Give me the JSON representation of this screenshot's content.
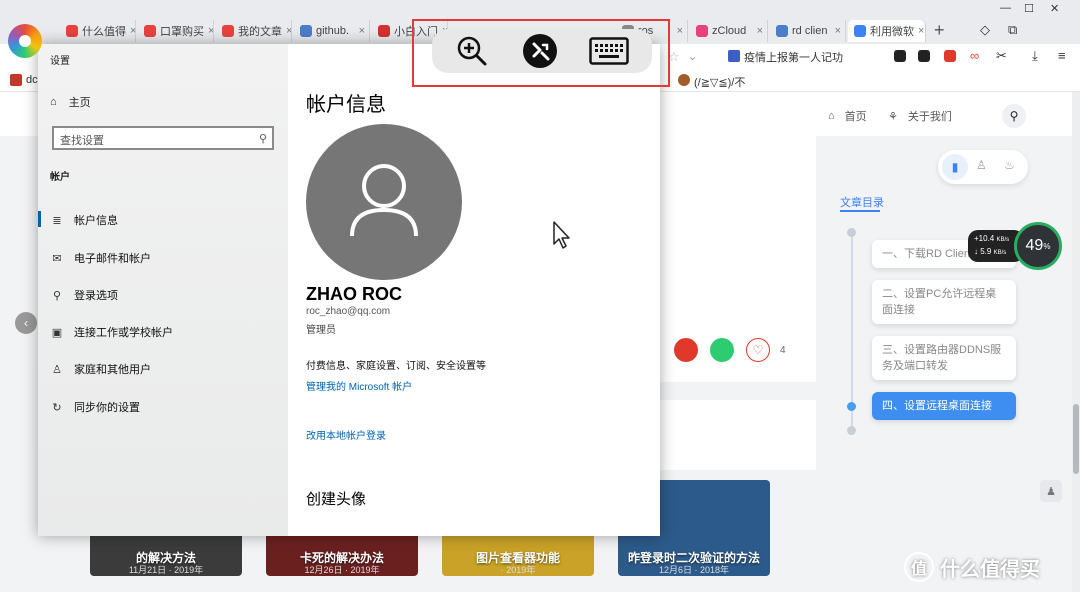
{
  "browser": {
    "tabs": [
      {
        "label": "什么值得",
        "color": "#e8423f"
      },
      {
        "label": "口罩购买",
        "color": "#e8423f"
      },
      {
        "label": "我的文章",
        "color": "#e8423f"
      },
      {
        "label": "github.",
        "color": "#4a7ec8"
      },
      {
        "label": "小白入门",
        "color": "#d63030"
      },
      {
        "label": "ros",
        "color": "#888888"
      },
      {
        "label": "zCloud",
        "color": "#e8427a"
      },
      {
        "label": "rd clien",
        "color": "#4a7ec8"
      },
      {
        "label": "利用微软",
        "color": "#3b82f6"
      }
    ],
    "tab_close": "×",
    "new_tab": "+",
    "address_hint": "疫情上报第一人记功",
    "bookmark_left": "dc",
    "bookmark_mid": "(/≧▽≦)/不",
    "win_min": "—",
    "win_max": "☐",
    "win_close": "✕"
  },
  "site": {
    "nav_home": "首页",
    "nav_about": "关于我们",
    "toc_title": "文章目录",
    "toc_items": [
      "一、下载RD Client",
      "二、设置PC允许远程桌面连接",
      "三、设置路由器DDNS服务及端口转发",
      "四、设置远程桌面连接"
    ],
    "like_count": "4",
    "net_up": "+10.4",
    "net_up_unit": "KB/s",
    "net_down": "5.9",
    "net_down_unit": "KB/s",
    "net_percent": "49",
    "net_percent_unit": "%",
    "thumbs": [
      {
        "title": "的解决方法",
        "date": "11月21日 · 2019年",
        "bg": "#3b3b3b"
      },
      {
        "title": "卡死的解决办法",
        "date": "12月26日 · 2019年",
        "bg": "#6b2020"
      },
      {
        "title": "图片查看器功能",
        "date": "· 2019年",
        "bg": "#c9a227"
      },
      {
        "title": "昨登录时二次验证的方法",
        "date": "12月6日 · 2018年",
        "bg": "#2c5a8a"
      }
    ],
    "watermark": "什么值得买"
  },
  "settings": {
    "window_title": "设置",
    "home": "主页",
    "search_placeholder": "查找设置",
    "section": "帐户",
    "nav": [
      {
        "label": "帐户信息",
        "icon": "≣"
      },
      {
        "label": "电子邮件和帐户",
        "icon": "✉"
      },
      {
        "label": "登录选项",
        "icon": "⚲"
      },
      {
        "label": "连接工作或学校帐户",
        "icon": "▣"
      },
      {
        "label": "家庭和其他用户",
        "icon": "♙"
      },
      {
        "label": "同步你的设置",
        "icon": "↻"
      }
    ],
    "page_title": "帐户信息",
    "user_name": "ZHAO ROC",
    "email": "roc_zhao@qq.com",
    "role": "管理员",
    "billing_text": "付费信息、家庭设置、订阅、安全设置等",
    "manage_link": "管理我的 Microsoft 帐户",
    "local_link": "改用本地帐户登录",
    "avatar_heading": "创建头像"
  },
  "remote_toolbar": {
    "zoom": "zoom-in",
    "remote": "remote-desktop",
    "keyboard": "keyboard"
  }
}
